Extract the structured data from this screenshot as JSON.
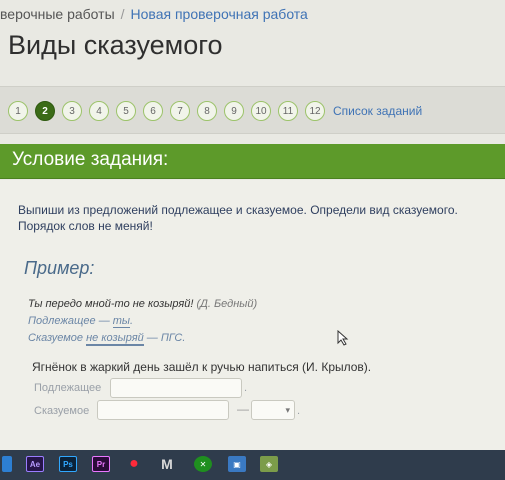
{
  "breadcrumb": {
    "prefix": "верочные работы",
    "separator": "/",
    "current": "Новая проверочная работа"
  },
  "page_title": "Виды сказуемого",
  "pager": {
    "pages": [
      "1",
      "2",
      "3",
      "4",
      "5",
      "6",
      "7",
      "8",
      "9",
      "10",
      "11",
      "12"
    ],
    "active_page": "2",
    "task_list_label": "Список заданий"
  },
  "condition": {
    "header": "Условие задания:"
  },
  "instruction": "Выпиши из предложений подлежащее и сказуемое. Определи вид сказуемого. Порядок слов не меняй!",
  "example": {
    "heading": "Пример:",
    "sentence": "Ты передо мной-то не козыряй!",
    "source": "(Д. Бедный)",
    "subject_prefix": "Подлежащее — ",
    "subject_word": "ты",
    "predicate_prefix": "Сказуемое ",
    "predicate_word": "не козыряй",
    "predicate_suffix": " — ПГС."
  },
  "task": {
    "sentence": "Ягнёнок в жаркий день зашёл к ручью напиться (И. Крылов).",
    "subject_label": "Подлежащее",
    "subject_value": "",
    "predicate_label": "Сказуемое",
    "predicate_value": "",
    "dash": "—",
    "type_value": ""
  },
  "taskbar": {
    "icons": [
      "windows-icon",
      "ae-icon",
      "ps-icon",
      "pr-icon",
      "opera-icon",
      "m-icon",
      "xbox-icon",
      "image-icon",
      "map-icon"
    ],
    "labels": {
      "ae": "Ae",
      "ps": "Ps",
      "pr": "Pr",
      "m": "M"
    },
    "colors": {
      "bar": "#2f3c4c",
      "green_header": "#5d9a2a",
      "active_page": "#3b6b17",
      "link": "#3f73b5"
    }
  }
}
